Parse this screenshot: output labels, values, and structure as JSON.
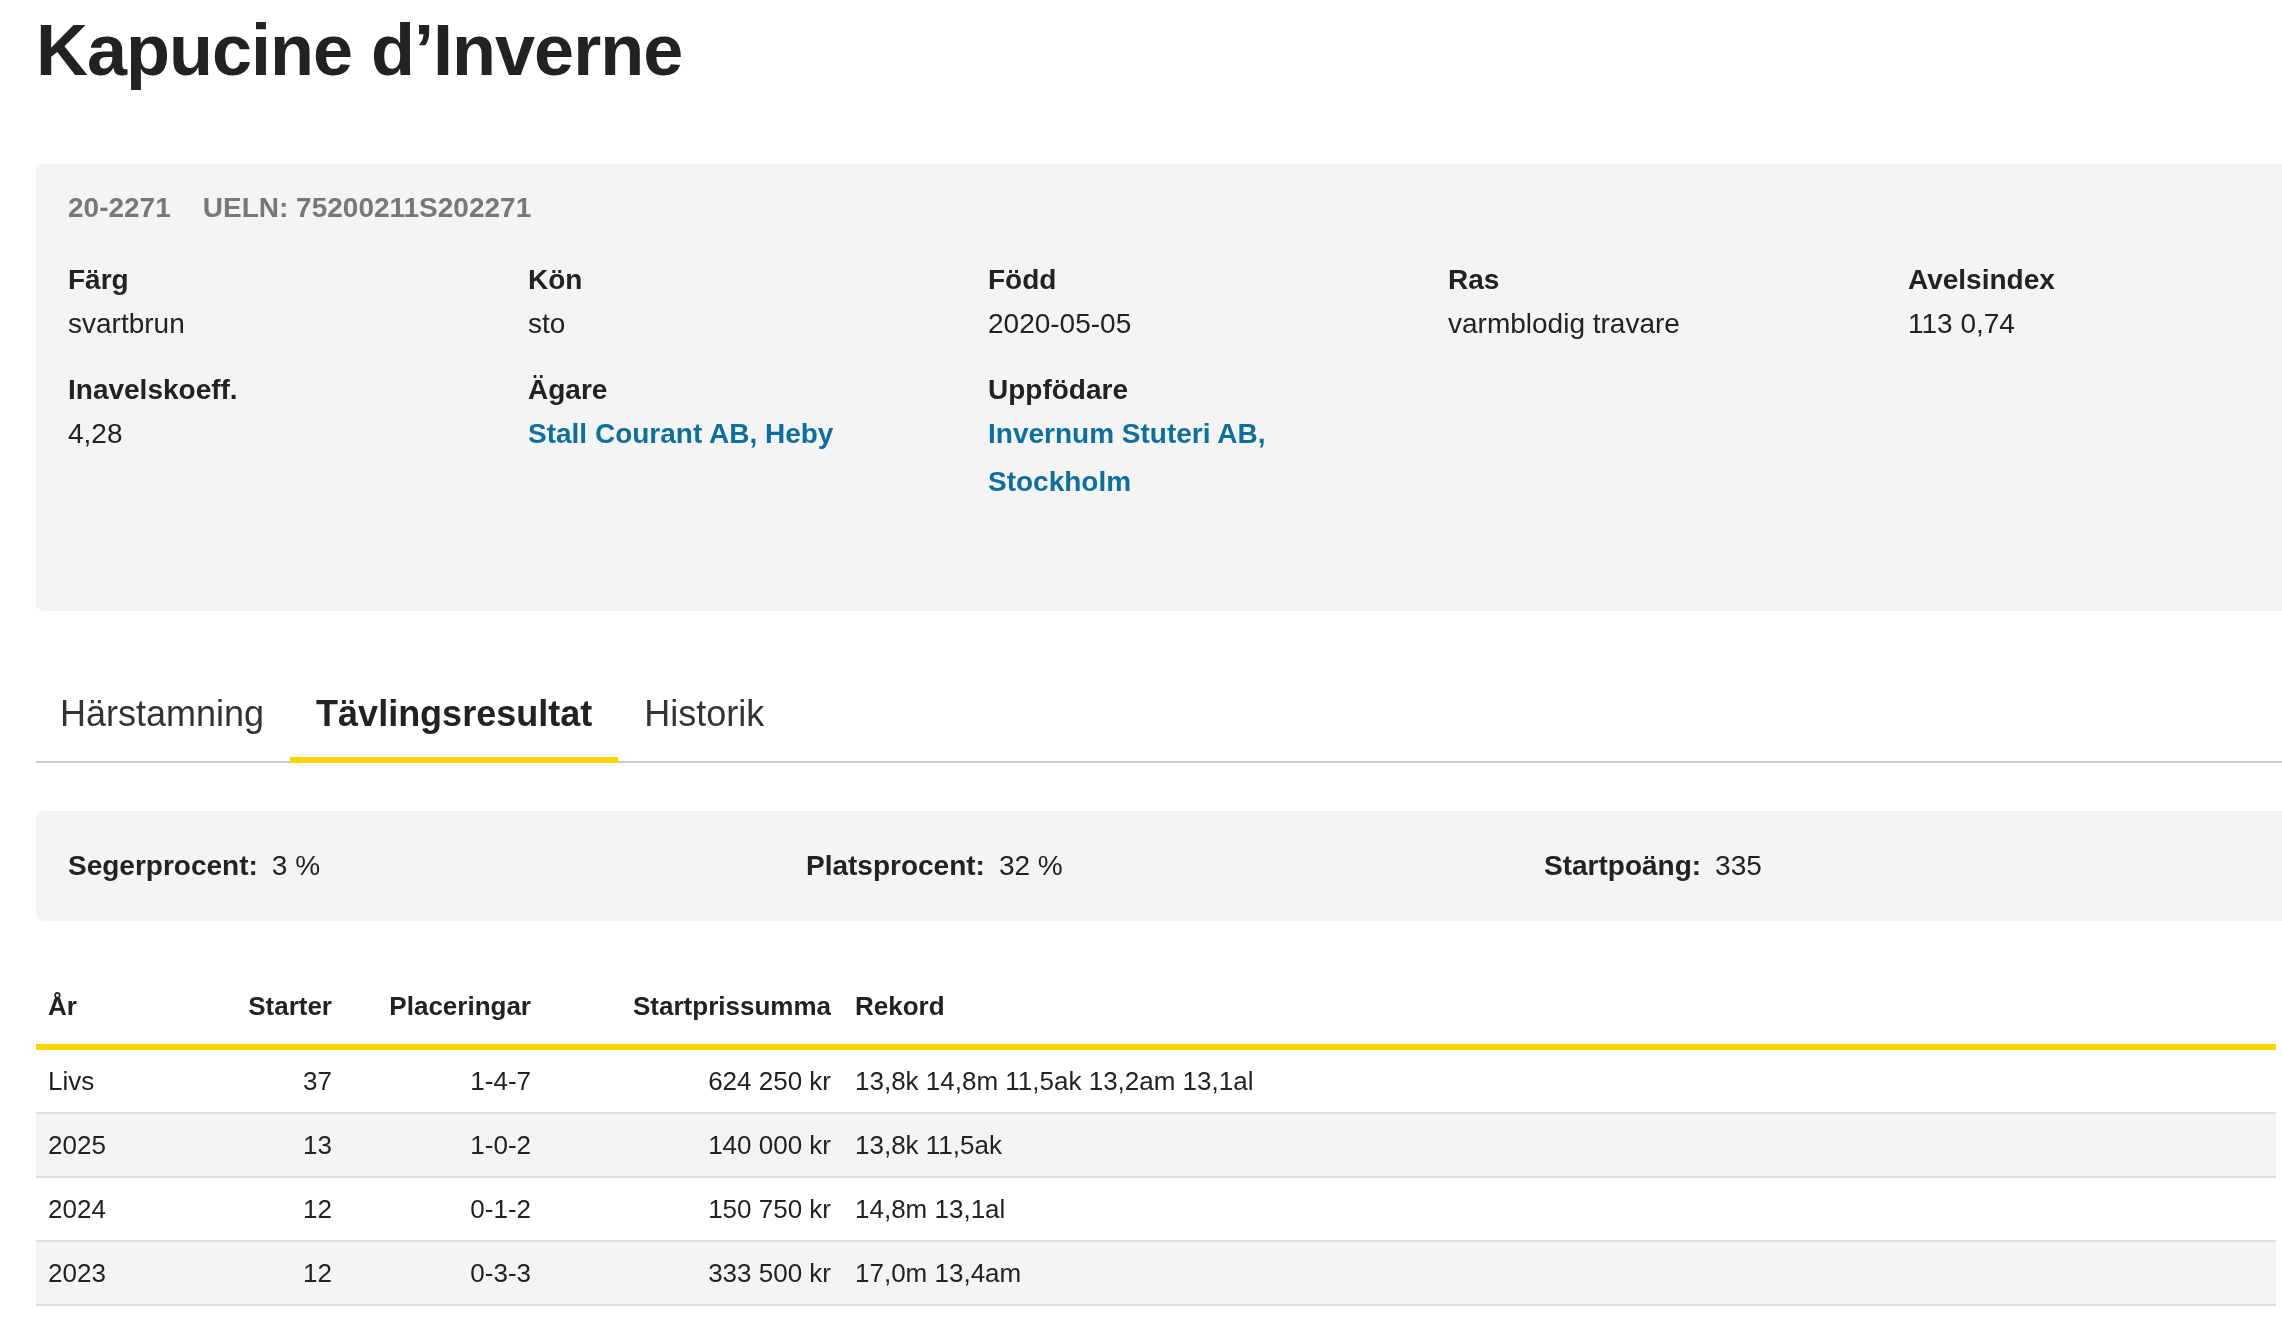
{
  "title": "Kapucine d’Inverne",
  "details": {
    "reg_number": "20-2271",
    "ueln": "UELN: 75200211S202271",
    "fields": [
      {
        "label": "Färg",
        "value": "svartbrun",
        "kind": "text"
      },
      {
        "label": "Kön",
        "value": "sto",
        "kind": "text"
      },
      {
        "label": "Född",
        "value": "2020-05-05",
        "kind": "text"
      },
      {
        "label": "Ras",
        "value": "varmblodig travare",
        "kind": "text"
      },
      {
        "label": "Avelsindex",
        "value": "113 0,74",
        "kind": "text"
      },
      {
        "label": "Inavelskoeff.",
        "value": "4,28",
        "kind": "text"
      },
      {
        "label": "Ägare",
        "value": "Stall Courant AB, Heby",
        "kind": "link"
      },
      {
        "label": "Uppfödare",
        "value": "Invernum Stuteri AB, Stockholm",
        "kind": "link"
      }
    ]
  },
  "tabs": [
    {
      "label": "Härstamning",
      "selected": false
    },
    {
      "label": "Tävlingsresultat",
      "selected": true
    },
    {
      "label": "Historik",
      "selected": false
    }
  ],
  "stats": [
    {
      "label": "Segerprocent:",
      "value": "3 %"
    },
    {
      "label": "Platsprocent:",
      "value": "32 %"
    },
    {
      "label": "Startpoäng:",
      "value": "335"
    }
  ],
  "table": {
    "columns": [
      "År",
      "Starter",
      "Placeringar",
      "Startprissumma",
      "Rekord"
    ],
    "rows": [
      [
        "Livs",
        "37",
        "1-4-7",
        "624 250 kr",
        "13,8k 14,8m 11,5ak 13,2am 13,1al"
      ],
      [
        "2025",
        "13",
        "1-0-2",
        "140 000 kr",
        "13,8k 11,5ak"
      ],
      [
        "2024",
        "12",
        "0-1-2",
        "150 750 kr",
        "14,8m 13,1al"
      ],
      [
        "2023",
        "12",
        "0-3-3",
        "333 500 kr",
        "17,0m 13,4am"
      ]
    ]
  }
}
